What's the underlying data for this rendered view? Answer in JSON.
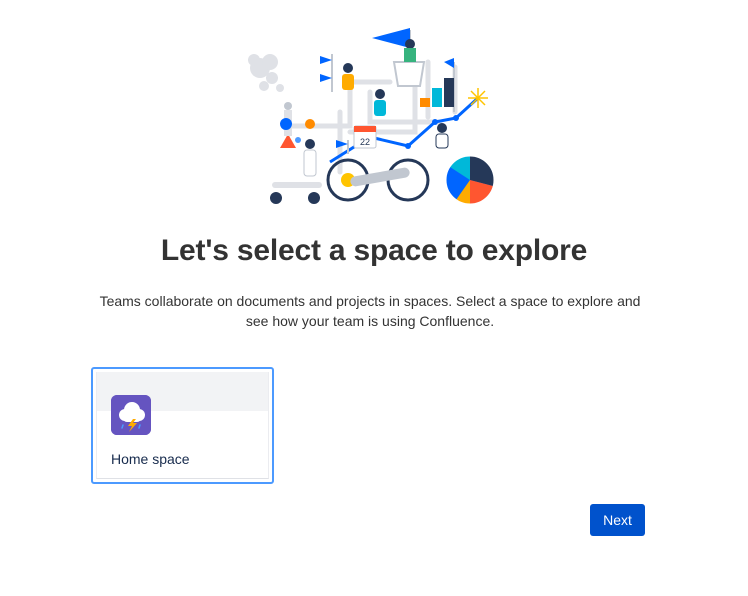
{
  "onboarding": {
    "title": "Let's select a space to explore",
    "subtitle": "Teams collaborate on documents and projects in spaces. Select a space to explore and see how your team is using Confluence.",
    "illustration_icon": "team-exploration-illustration",
    "calendar_day": "22"
  },
  "spaces": [
    {
      "label": "Home space",
      "icon": "storm-cloud-icon",
      "selected": true
    }
  ],
  "actions": {
    "next_label": "Next"
  },
  "colors": {
    "primary": "#0052cc",
    "selected_border": "#4c9aff",
    "space_icon_bg": "#6554c0"
  }
}
